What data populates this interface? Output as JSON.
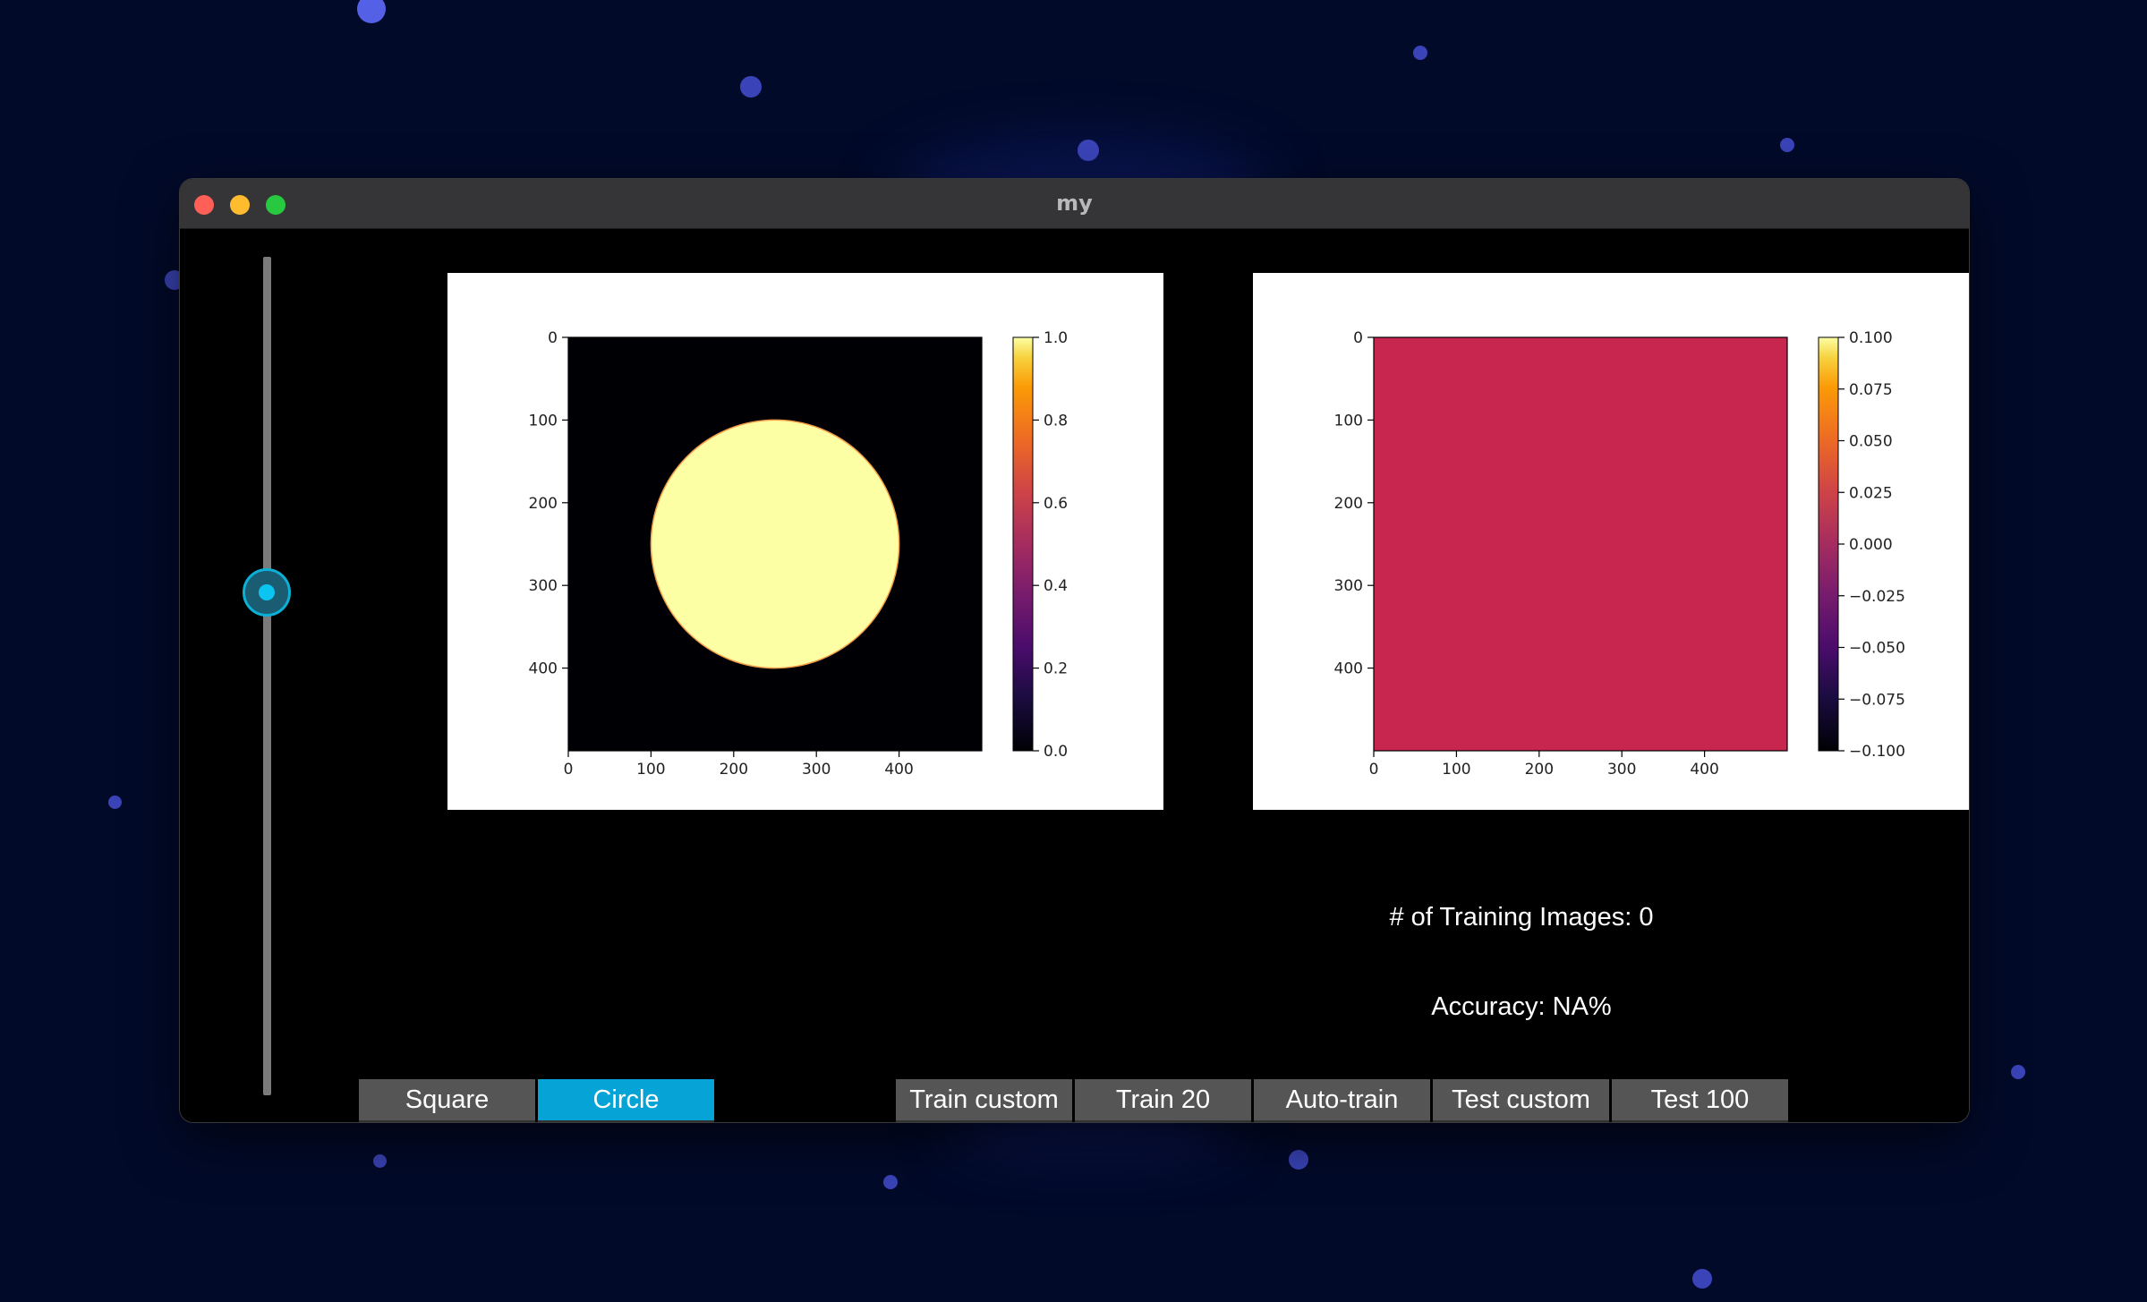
{
  "window": {
    "title": "my"
  },
  "slider": {
    "value": 0.6
  },
  "shape_buttons": [
    {
      "label": "Square",
      "active": false
    },
    {
      "label": "Circle",
      "active": true
    }
  ],
  "action_buttons": [
    {
      "label": "Train custom"
    },
    {
      "label": "Train 20"
    },
    {
      "label": "Auto-train"
    },
    {
      "label": "Test custom"
    },
    {
      "label": "Test 100"
    }
  ],
  "info": {
    "training_images": "# of Training Images: 0",
    "accuracy": "Accuracy: NA%"
  },
  "chart_data": [
    {
      "type": "heatmap",
      "colormap": "inferno",
      "content": "circle",
      "shape": {
        "center": [
          250,
          250
        ],
        "radius": 150,
        "value": 1.0,
        "background": 0.0
      },
      "x_ticks": [
        "0",
        "100",
        "200",
        "300",
        "400"
      ],
      "y_ticks": [
        "0",
        "100",
        "200",
        "300",
        "400"
      ],
      "xlim": [
        0,
        500
      ],
      "ylim": [
        500,
        0
      ],
      "colorbar_ticks": [
        "0.0",
        "0.2",
        "0.4",
        "0.6",
        "0.8",
        "1.0"
      ],
      "colorbar_range": [
        0.0,
        1.0
      ]
    },
    {
      "type": "heatmap",
      "colormap": "inferno",
      "content": "uniform",
      "fill_value": 0.0,
      "fill_color": "#c8254f",
      "x_ticks": [
        "0",
        "100",
        "200",
        "300",
        "400"
      ],
      "y_ticks": [
        "0",
        "100",
        "200",
        "300",
        "400"
      ],
      "xlim": [
        0,
        500
      ],
      "ylim": [
        500,
        0
      ],
      "colorbar_ticks": [
        "−0.100",
        "−0.075",
        "−0.050",
        "−0.025",
        "0.000",
        "0.025",
        "0.050",
        "0.075",
        "0.100"
      ],
      "colorbar_range": [
        -0.1,
        0.1
      ]
    }
  ]
}
